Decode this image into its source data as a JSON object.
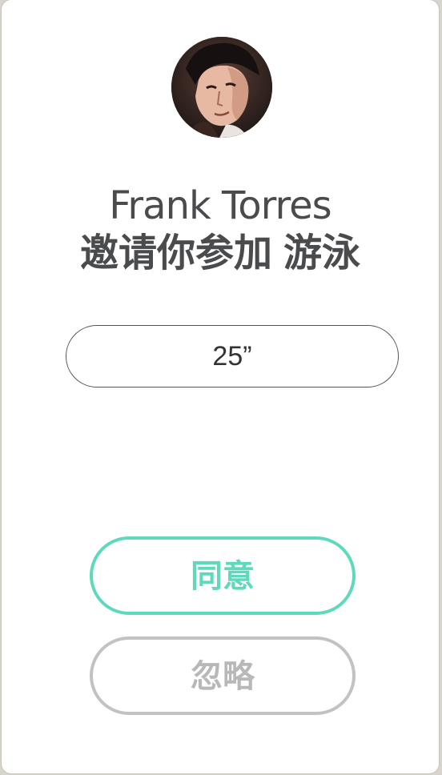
{
  "inviter": {
    "name": "Frank Torres",
    "avatar_icon": "user-avatar"
  },
  "invite": {
    "text": "邀请你参加",
    "activity": "游泳"
  },
  "timer": {
    "value": "25”"
  },
  "actions": {
    "agree_label": "同意",
    "ignore_label": "忽略"
  },
  "colors": {
    "accent": "#5fd9bc",
    "muted": "#c2c2c2",
    "text": "#4a4b4d"
  }
}
